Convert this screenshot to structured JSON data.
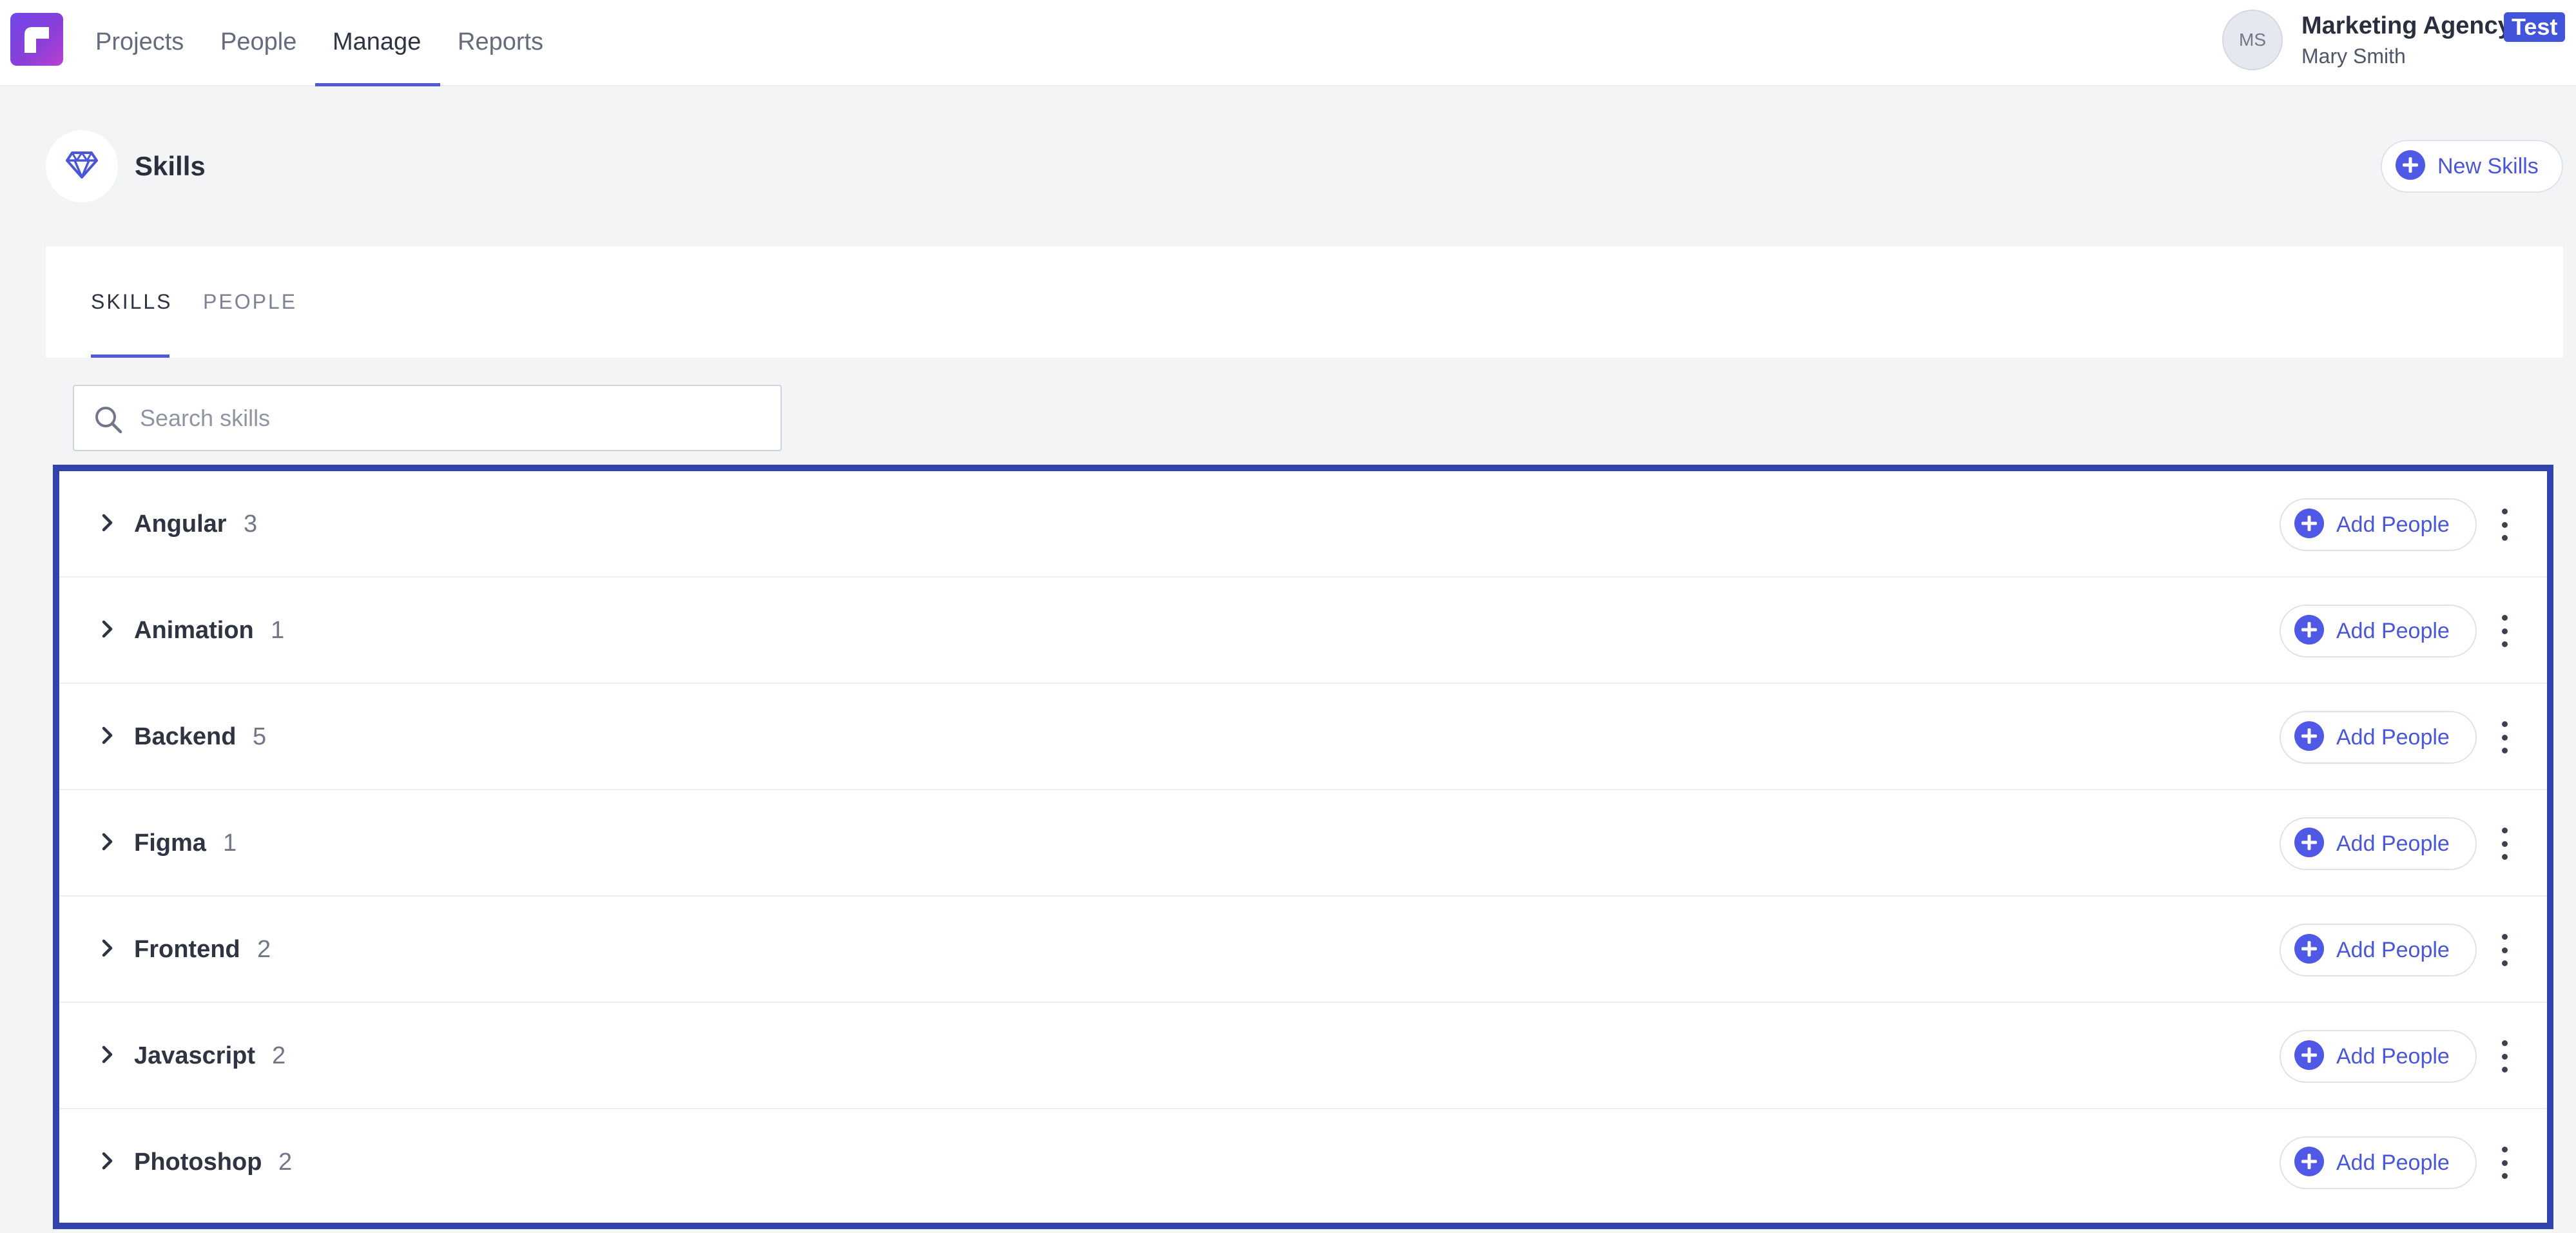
{
  "nav": {
    "items": [
      {
        "label": "Projects",
        "active": false
      },
      {
        "label": "People",
        "active": false
      },
      {
        "label": "Manage",
        "active": true
      },
      {
        "label": "Reports",
        "active": false
      }
    ]
  },
  "account": {
    "initials": "MS",
    "org_name": "Marketing Agency",
    "badge": "Test",
    "user_name": "Mary Smith"
  },
  "page": {
    "icon": "diamond-icon",
    "title": "Skills",
    "new_button_label": "New Skills"
  },
  "tabs": [
    {
      "label": "SKILLS",
      "active": true
    },
    {
      "label": "PEOPLE",
      "active": false
    }
  ],
  "search": {
    "placeholder": "Search skills",
    "value": ""
  },
  "skills": [
    {
      "name": "Angular",
      "count": "3"
    },
    {
      "name": "Animation",
      "count": "1"
    },
    {
      "name": "Backend",
      "count": "5"
    },
    {
      "name": "Figma",
      "count": "1"
    },
    {
      "name": "Frontend",
      "count": "2"
    },
    {
      "name": "Javascript",
      "count": "2"
    },
    {
      "name": "Photoshop",
      "count": "2"
    }
  ],
  "row_action_label": "Add People",
  "colors": {
    "accent": "#4f59d9",
    "badge": "#4254d9",
    "highlight_frame": "#3343ad",
    "background": "#f3f4f6"
  }
}
